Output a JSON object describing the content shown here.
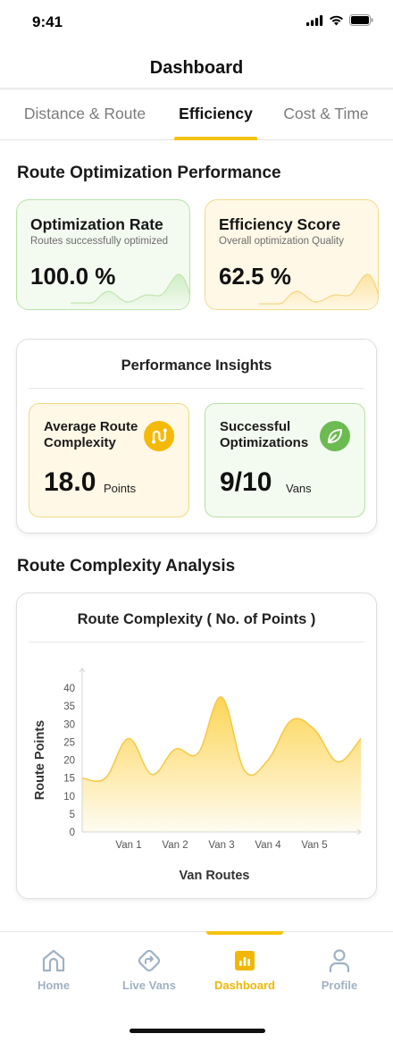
{
  "status": {
    "time": "9:41"
  },
  "header": {
    "title": "Dashboard"
  },
  "tabs": [
    {
      "label": "Distance & Route",
      "active": false
    },
    {
      "label": "Efficiency",
      "active": true
    },
    {
      "label": "Cost & Time",
      "active": false
    }
  ],
  "optimization": {
    "section_title": "Route Optimization Performance",
    "rate": {
      "title": "Optimization Rate",
      "subtitle": "Routes successfully optimized",
      "value": "100.0 %"
    },
    "score": {
      "title": "Efficiency Score",
      "subtitle": "Overall optimization Quality",
      "value": "62.5 %"
    }
  },
  "insights": {
    "title": "Performance Insights",
    "complexity": {
      "title": "Average Route Complexity",
      "value": "18.0",
      "unit": "Points",
      "icon": "route-icon"
    },
    "successful": {
      "title": "Successful Optimizations",
      "value": "9/10",
      "unit": "Vans",
      "icon": "leaf-icon"
    }
  },
  "complexity_section": {
    "title": "Route Complexity Analysis"
  },
  "chart_data": {
    "type": "area",
    "title": "Route Complexity ( No. of Points )",
    "xlabel": "Van Routes",
    "ylabel": "Route Points",
    "x_tick_labels": [
      "Van 1",
      "Van 2",
      "Van 3",
      "Van 4",
      "Van 5"
    ],
    "y_ticks": [
      0,
      5,
      10,
      15,
      20,
      25,
      30,
      35,
      40
    ],
    "ylim": [
      0,
      40
    ],
    "x": [
      0,
      0.5,
      1,
      1.5,
      2,
      2.5,
      3,
      3.5,
      4,
      4.5,
      5,
      5.5,
      6
    ],
    "values": [
      15,
      15,
      26,
      16,
      23,
      22,
      37.5,
      17,
      20,
      31,
      28.5,
      19.5,
      26
    ],
    "grid": false,
    "fill_color": "#fcd34d",
    "line_color": "#f7c744"
  },
  "nav": [
    {
      "label": "Home",
      "icon": "home-icon",
      "active": false
    },
    {
      "label": "Live Vans",
      "icon": "navigation-icon",
      "active": false
    },
    {
      "label": "Dashboard",
      "icon": "chart-icon",
      "active": true
    },
    {
      "label": "Profile",
      "icon": "person-icon",
      "active": false
    }
  ],
  "colors": {
    "accent": "#f5c20d",
    "green": "#6bbb50",
    "nav_inactive": "#9fb1c4"
  }
}
